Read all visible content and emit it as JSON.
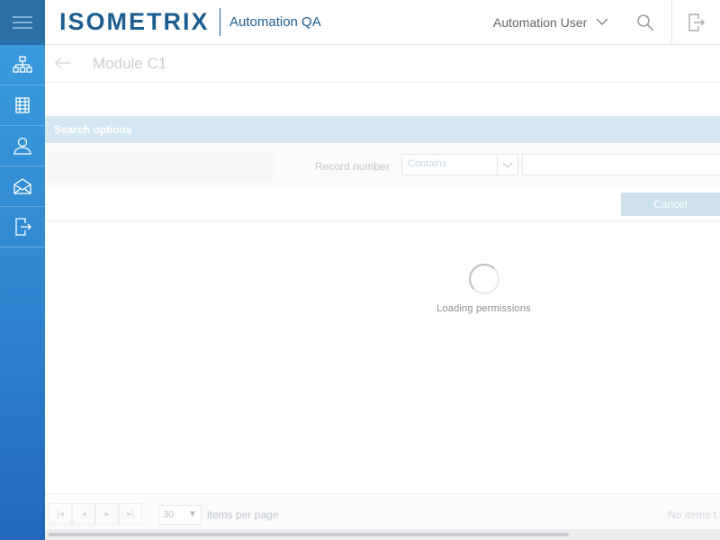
{
  "header": {
    "logo_text": "ISOMETRIX",
    "app_name": "Automation QA",
    "user_name": "Automation User",
    "icons": [
      "hamburger-menu-icon",
      "chevron-down-icon",
      "search-icon",
      "logout-icon"
    ]
  },
  "sidebar": {
    "items": [
      {
        "icon": "org-chart-icon"
      },
      {
        "icon": "module-grid-icon"
      },
      {
        "icon": "user-icon"
      },
      {
        "icon": "mail-icon"
      },
      {
        "icon": "exit-icon"
      }
    ]
  },
  "page": {
    "title": "Module C1"
  },
  "search": {
    "header": "Search options",
    "record_label": "Record number",
    "operator_value": "Contains",
    "input_value": "",
    "cancel_label": "Cancel"
  },
  "loading": {
    "text": "Loading permissions"
  },
  "pager": {
    "first": "|◂",
    "prev": "◂",
    "next": "▸",
    "last": "▸|",
    "per_page_value": "30",
    "per_page_arrow": "▼",
    "items_per_page_label": "items per page",
    "status": "No items t"
  },
  "colors": {
    "brand": "#1d5e91",
    "sidebar_top": "#3a9ee0",
    "sidebar_bottom": "#2467bd",
    "search_header_bg": "#d5e7f2"
  }
}
